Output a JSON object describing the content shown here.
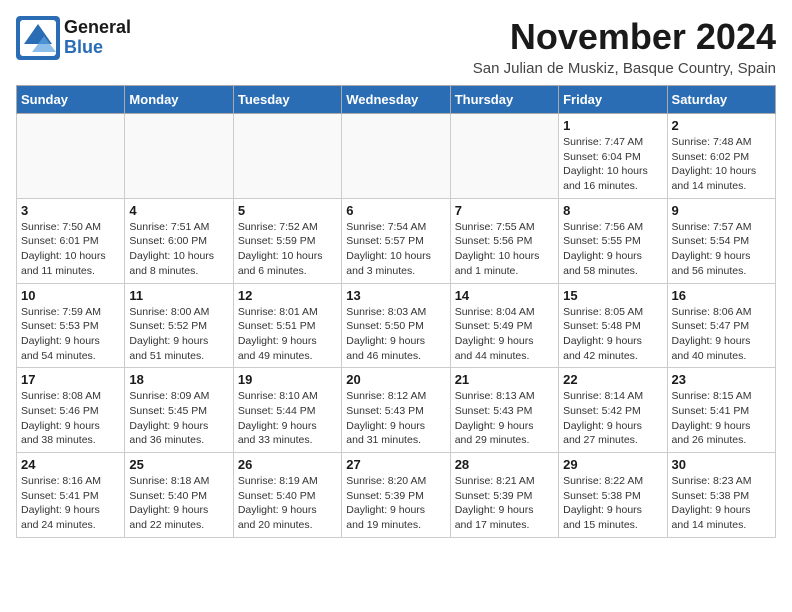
{
  "header": {
    "logo_general": "General",
    "logo_blue": "Blue",
    "month_title": "November 2024",
    "location": "San Julian de Muskiz, Basque Country, Spain"
  },
  "weekdays": [
    "Sunday",
    "Monday",
    "Tuesday",
    "Wednesday",
    "Thursday",
    "Friday",
    "Saturday"
  ],
  "weeks": [
    [
      {
        "day": "",
        "info": ""
      },
      {
        "day": "",
        "info": ""
      },
      {
        "day": "",
        "info": ""
      },
      {
        "day": "",
        "info": ""
      },
      {
        "day": "",
        "info": ""
      },
      {
        "day": "1",
        "info": "Sunrise: 7:47 AM\nSunset: 6:04 PM\nDaylight: 10 hours\nand 16 minutes."
      },
      {
        "day": "2",
        "info": "Sunrise: 7:48 AM\nSunset: 6:02 PM\nDaylight: 10 hours\nand 14 minutes."
      }
    ],
    [
      {
        "day": "3",
        "info": "Sunrise: 7:50 AM\nSunset: 6:01 PM\nDaylight: 10 hours\nand 11 minutes."
      },
      {
        "day": "4",
        "info": "Sunrise: 7:51 AM\nSunset: 6:00 PM\nDaylight: 10 hours\nand 8 minutes."
      },
      {
        "day": "5",
        "info": "Sunrise: 7:52 AM\nSunset: 5:59 PM\nDaylight: 10 hours\nand 6 minutes."
      },
      {
        "day": "6",
        "info": "Sunrise: 7:54 AM\nSunset: 5:57 PM\nDaylight: 10 hours\nand 3 minutes."
      },
      {
        "day": "7",
        "info": "Sunrise: 7:55 AM\nSunset: 5:56 PM\nDaylight: 10 hours\nand 1 minute."
      },
      {
        "day": "8",
        "info": "Sunrise: 7:56 AM\nSunset: 5:55 PM\nDaylight: 9 hours\nand 58 minutes."
      },
      {
        "day": "9",
        "info": "Sunrise: 7:57 AM\nSunset: 5:54 PM\nDaylight: 9 hours\nand 56 minutes."
      }
    ],
    [
      {
        "day": "10",
        "info": "Sunrise: 7:59 AM\nSunset: 5:53 PM\nDaylight: 9 hours\nand 54 minutes."
      },
      {
        "day": "11",
        "info": "Sunrise: 8:00 AM\nSunset: 5:52 PM\nDaylight: 9 hours\nand 51 minutes."
      },
      {
        "day": "12",
        "info": "Sunrise: 8:01 AM\nSunset: 5:51 PM\nDaylight: 9 hours\nand 49 minutes."
      },
      {
        "day": "13",
        "info": "Sunrise: 8:03 AM\nSunset: 5:50 PM\nDaylight: 9 hours\nand 46 minutes."
      },
      {
        "day": "14",
        "info": "Sunrise: 8:04 AM\nSunset: 5:49 PM\nDaylight: 9 hours\nand 44 minutes."
      },
      {
        "day": "15",
        "info": "Sunrise: 8:05 AM\nSunset: 5:48 PM\nDaylight: 9 hours\nand 42 minutes."
      },
      {
        "day": "16",
        "info": "Sunrise: 8:06 AM\nSunset: 5:47 PM\nDaylight: 9 hours\nand 40 minutes."
      }
    ],
    [
      {
        "day": "17",
        "info": "Sunrise: 8:08 AM\nSunset: 5:46 PM\nDaylight: 9 hours\nand 38 minutes."
      },
      {
        "day": "18",
        "info": "Sunrise: 8:09 AM\nSunset: 5:45 PM\nDaylight: 9 hours\nand 36 minutes."
      },
      {
        "day": "19",
        "info": "Sunrise: 8:10 AM\nSunset: 5:44 PM\nDaylight: 9 hours\nand 33 minutes."
      },
      {
        "day": "20",
        "info": "Sunrise: 8:12 AM\nSunset: 5:43 PM\nDaylight: 9 hours\nand 31 minutes."
      },
      {
        "day": "21",
        "info": "Sunrise: 8:13 AM\nSunset: 5:43 PM\nDaylight: 9 hours\nand 29 minutes."
      },
      {
        "day": "22",
        "info": "Sunrise: 8:14 AM\nSunset: 5:42 PM\nDaylight: 9 hours\nand 27 minutes."
      },
      {
        "day": "23",
        "info": "Sunrise: 8:15 AM\nSunset: 5:41 PM\nDaylight: 9 hours\nand 26 minutes."
      }
    ],
    [
      {
        "day": "24",
        "info": "Sunrise: 8:16 AM\nSunset: 5:41 PM\nDaylight: 9 hours\nand 24 minutes."
      },
      {
        "day": "25",
        "info": "Sunrise: 8:18 AM\nSunset: 5:40 PM\nDaylight: 9 hours\nand 22 minutes."
      },
      {
        "day": "26",
        "info": "Sunrise: 8:19 AM\nSunset: 5:40 PM\nDaylight: 9 hours\nand 20 minutes."
      },
      {
        "day": "27",
        "info": "Sunrise: 8:20 AM\nSunset: 5:39 PM\nDaylight: 9 hours\nand 19 minutes."
      },
      {
        "day": "28",
        "info": "Sunrise: 8:21 AM\nSunset: 5:39 PM\nDaylight: 9 hours\nand 17 minutes."
      },
      {
        "day": "29",
        "info": "Sunrise: 8:22 AM\nSunset: 5:38 PM\nDaylight: 9 hours\nand 15 minutes."
      },
      {
        "day": "30",
        "info": "Sunrise: 8:23 AM\nSunset: 5:38 PM\nDaylight: 9 hours\nand 14 minutes."
      }
    ]
  ]
}
